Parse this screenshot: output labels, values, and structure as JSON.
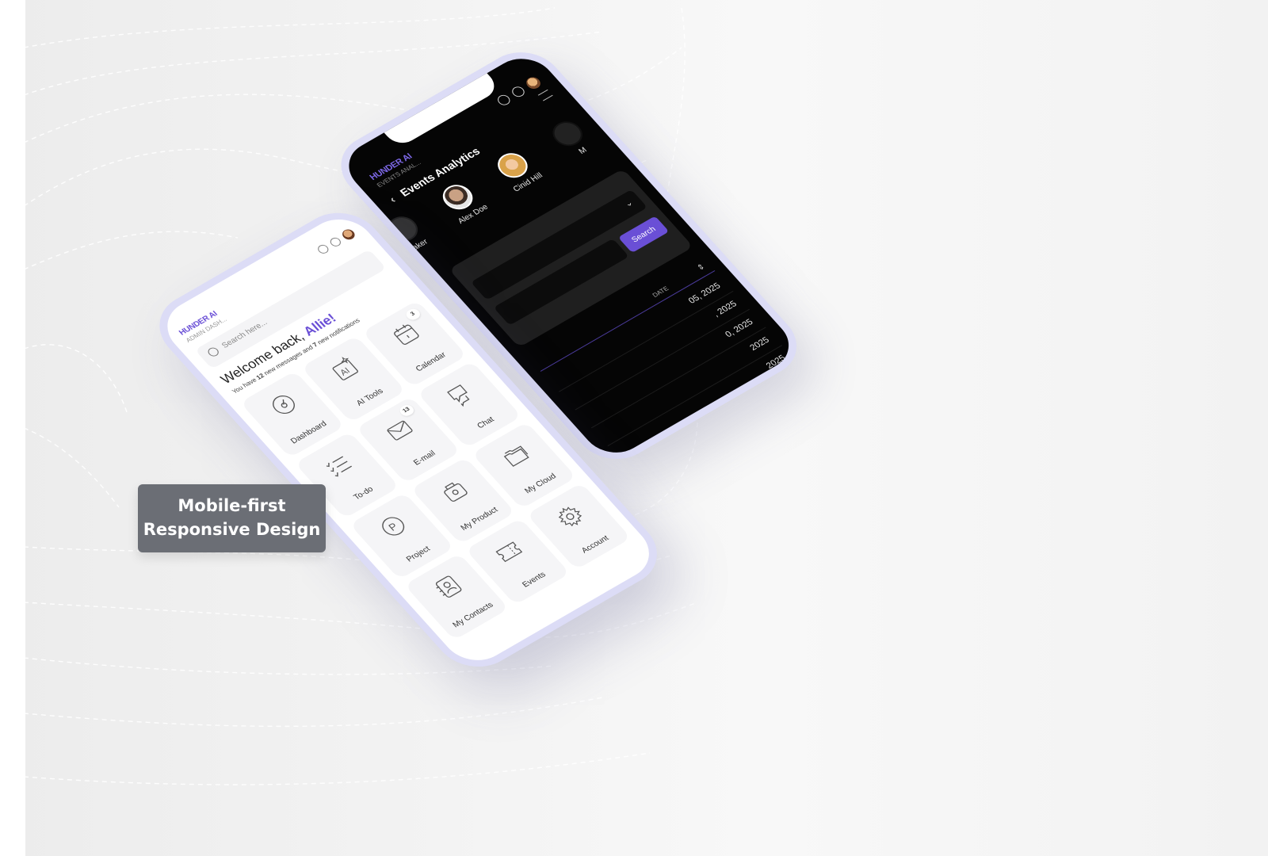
{
  "caption": {
    "line1": "Mobile-first",
    "line2": "Responsive Design"
  },
  "dark_phone": {
    "brand": "HUNDER AI",
    "subtitle": "EVENTS ANAL...",
    "title": "Events Analytics",
    "speakers": [
      {
        "name": "eaker",
        "color": "#444444"
      },
      {
        "name": "Alex Doe",
        "color": "#bdbdbd"
      },
      {
        "name": "Cinid Hill",
        "color": "#d9a24a"
      },
      {
        "name": "M",
        "color": "#444444"
      }
    ],
    "search_button": "Search",
    "table_header": "DATE",
    "rows": [
      "05, 2025",
      ", 2025",
      "0, 2025",
      "2025",
      "2025"
    ],
    "accent": "#6a4fd6"
  },
  "light_phone": {
    "brand": "HUNDER AI",
    "subtitle": "ADMIN DASH...",
    "search_placeholder": "Search here...",
    "welcome_prefix": "Welcome back,",
    "welcome_name": "Allie!",
    "notice_pre": "You have",
    "notice_msgs": "12",
    "notice_mid": "new messages and",
    "notice_notif": "7",
    "notice_post": "new notifications",
    "tiles": [
      {
        "label": "Dashboard",
        "icon": "dashboard-icon"
      },
      {
        "label": "AI Tools",
        "icon": "ai-tools-icon"
      },
      {
        "label": "Calendar",
        "icon": "calendar-icon",
        "badge": "3"
      },
      {
        "label": "To-do",
        "icon": "todo-icon"
      },
      {
        "label": "E-mail",
        "icon": "email-icon",
        "badge": "13"
      },
      {
        "label": "Chat",
        "icon": "chat-icon"
      },
      {
        "label": "Project",
        "icon": "project-icon"
      },
      {
        "label": "My Product",
        "icon": "product-icon"
      },
      {
        "label": "My Cloud",
        "icon": "cloud-icon"
      },
      {
        "label": "My Contacts",
        "icon": "contacts-icon"
      },
      {
        "label": "Events",
        "icon": "ticket-icon"
      },
      {
        "label": "Account",
        "icon": "gear-icon"
      }
    ],
    "accent": "#6a4fd6"
  }
}
